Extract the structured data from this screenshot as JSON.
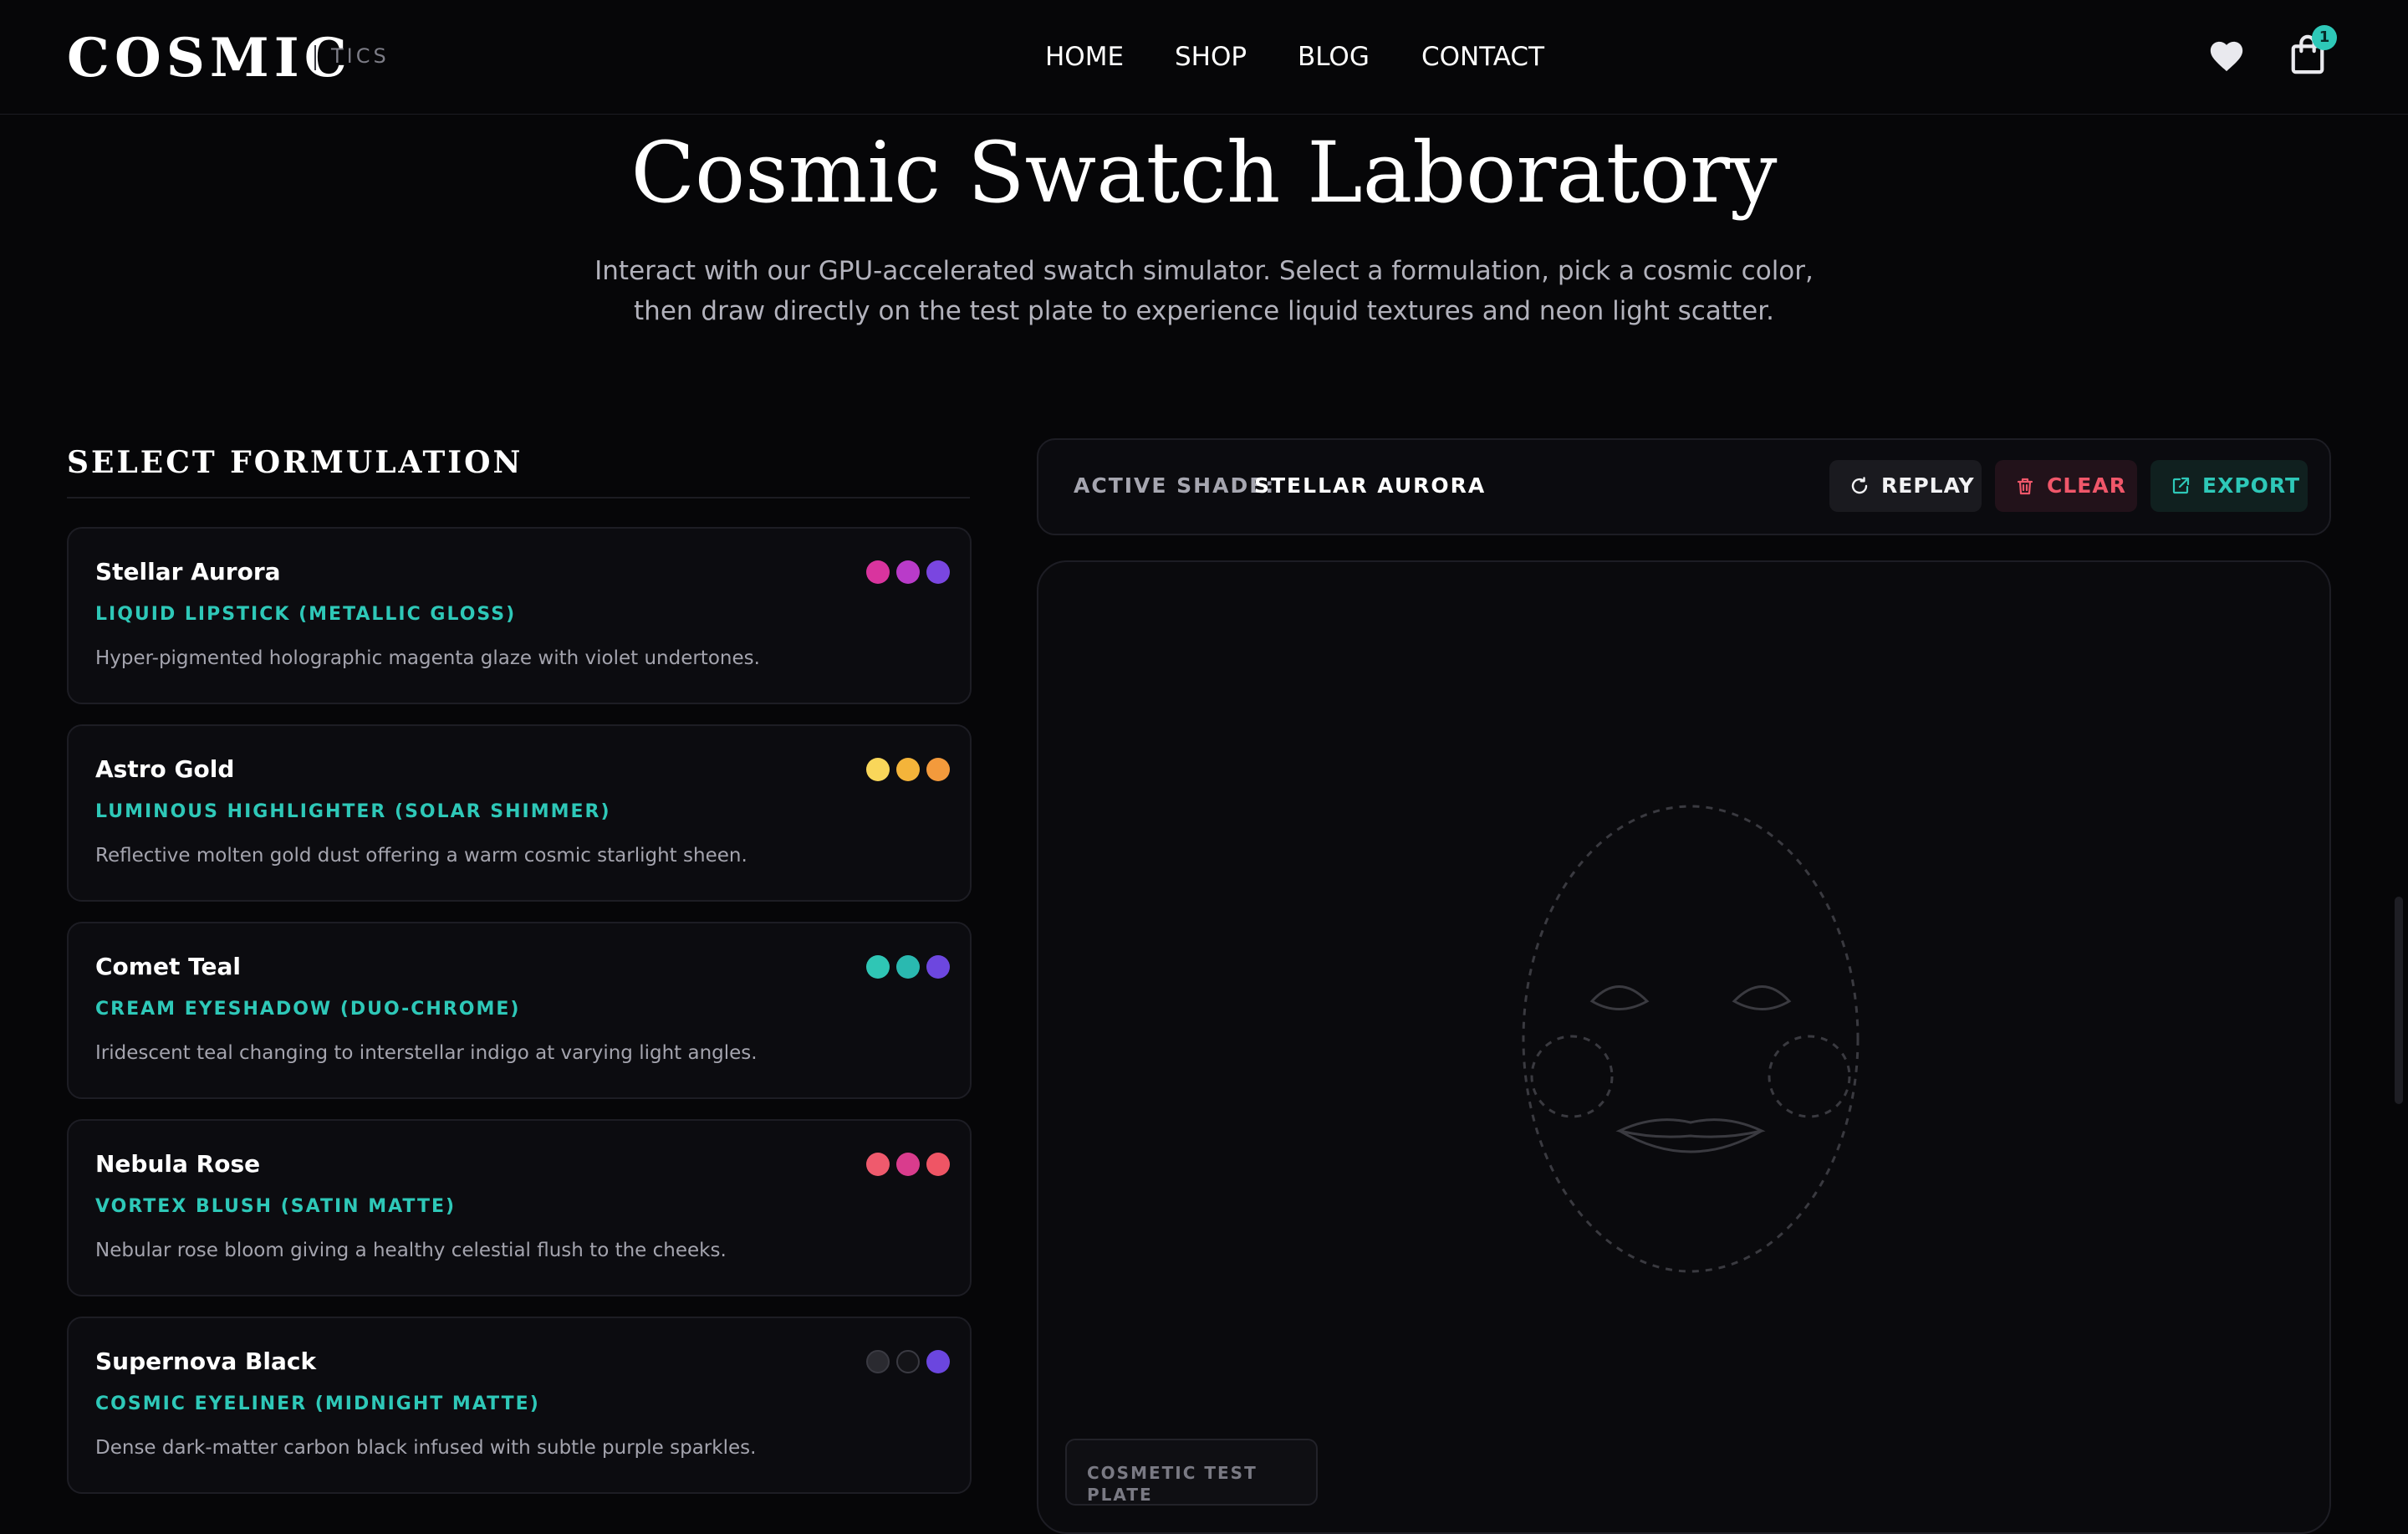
{
  "brand": {
    "name": "COSMIC",
    "suffix": "TICS"
  },
  "nav": [
    {
      "label": "HOME"
    },
    {
      "label": "SHOP"
    },
    {
      "label": "BLOG"
    },
    {
      "label": "CONTACT"
    }
  ],
  "header_icons": {
    "wishlist": "heart-icon",
    "cart": "shopping-bag-icon",
    "cart_count": "1"
  },
  "hero": {
    "title": "Cosmic Swatch Laboratory",
    "subtitle_line1": "Interact with our GPU-accelerated swatch simulator. Select a formulation, pick a cosmic color,",
    "subtitle_line2": "then draw directly on the test plate to experience liquid textures and neon light scatter."
  },
  "formulation_section": {
    "title": "SELECT FORMULATION",
    "items": [
      {
        "name": "Stellar Aurora",
        "type": "LIQUID LIPSTICK (METALLIC GLOSS)",
        "description": "Hyper-pigmented holographic magenta glaze with violet undertones.",
        "colors": [
          "#d9349e",
          "#b93bc9",
          "#7a46e0"
        ]
      },
      {
        "name": "Astro Gold",
        "type": "LUMINOUS HIGHLIGHTER (SOLAR SHIMMER)",
        "description": "Reflective molten gold dust offering a warm cosmic starlight sheen.",
        "colors": [
          "#f9d65a",
          "#f4b43a",
          "#f39a3c"
        ]
      },
      {
        "name": "Comet Teal",
        "type": "CREAM EYESHADOW (DUO-CHROME)",
        "description": "Iridescent teal changing to interstellar indigo at varying light angles.",
        "colors": [
          "#2fc6b5",
          "#2ab9b0",
          "#6d47df"
        ]
      },
      {
        "name": "Nebula Rose",
        "type": "VORTEX BLUSH (SATIN MATTE)",
        "description": "Nebular rose bloom giving a healthy celestial flush to the cheeks.",
        "colors": [
          "#ef5a6d",
          "#d93c8d",
          "#ef5565"
        ]
      },
      {
        "name": "Supernova Black",
        "type": "COSMIC EYELINER (MIDNIGHT MATTE)",
        "description": "Dense dark-matter carbon black infused with subtle purple sparkles.",
        "colors": [
          "#2a2a30",
          "#141418",
          "#6b46df"
        ]
      }
    ]
  },
  "plate_controls": {
    "active_label": "ACTIVE SHADE:",
    "active_value": "STELLAR AURORA",
    "replay_label": "REPLAY",
    "clear_label": "CLEAR",
    "export_label": "EXPORT"
  },
  "plate": {
    "tag": "COSMETIC TEST PLATE"
  },
  "colors": {
    "accent": "#2ec8b8",
    "danger": "#f0576a",
    "background": "#060608"
  }
}
